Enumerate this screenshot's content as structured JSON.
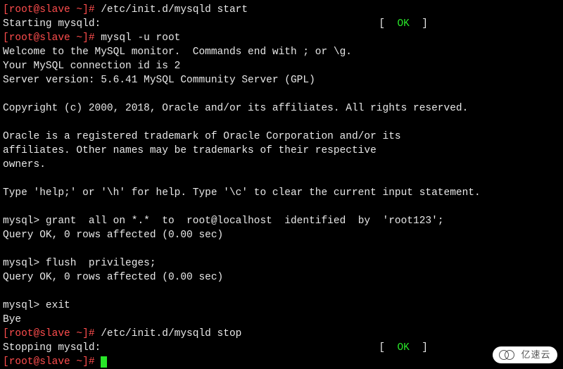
{
  "prompt": "[root@slave ~]# ",
  "mysql_prompt": "mysql> ",
  "cmd_start": "/etc/init.d/mysqld start",
  "starting": "Starting mysqld:",
  "ok_l": "[  ",
  "ok_text": "OK",
  "ok_r": "  ]",
  "cmd_mysql": "mysql -u root",
  "welcome": "Welcome to the MySQL monitor.  Commands end with ; or \\g.",
  "conn_id": "Your MySQL connection id is 2",
  "server_ver": "Server version: 5.6.41 MySQL Community Server (GPL)",
  "copyright": "Copyright (c) 2000, 2018, Oracle and/or its affiliates. All rights reserved.",
  "tm1": "Oracle is a registered trademark of Oracle Corporation and/or its",
  "tm2": "affiliates. Other names may be trademarks of their respective",
  "tm3": "owners.",
  "help": "Type 'help;' or '\\h' for help. Type '\\c' to clear the current input statement.",
  "grant": "grant  all on *.*  to  root@localhost  identified  by  'root123';",
  "query_ok": "Query OK, 0 rows affected (0.00 sec)",
  "flush": "flush  privileges;",
  "exit": "exit",
  "bye": "Bye",
  "cmd_stop": "/etc/init.d/mysqld stop",
  "stopping": "Stopping mysqld:",
  "watermark": "亿速云"
}
